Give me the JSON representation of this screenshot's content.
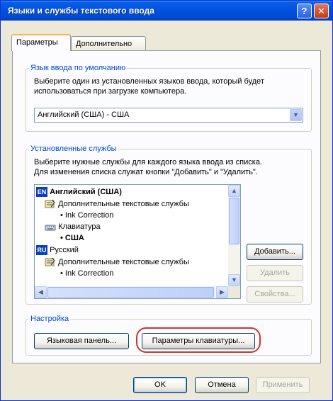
{
  "window": {
    "title": "Языки и службы текстового ввода",
    "help_glyph": "?",
    "close_glyph": "✕"
  },
  "tabs": [
    "Параметры",
    "Дополнительно"
  ],
  "default_language": {
    "legend": "Язык ввода по умолчанию",
    "description_line1": "Выберите один из установленных языков ввода, который будет",
    "description_line2": "использоваться при загрузке компьютера.",
    "selected": "Английский (США) - США"
  },
  "installed_services": {
    "legend": "Установленные службы",
    "description_line1": "Выберите нужные службы для каждого языка ввода из списка.",
    "description_line2": "Для изменения списка служат кнопки \"Добавить\" и \"Удалить\".",
    "tree": {
      "en_badge": "EN",
      "en_label": "Английский (США)",
      "en_text_services": "Дополнительные текстовые службы",
      "en_ink": "Ink Correction",
      "en_keyboard": "Клавиатура",
      "en_keyboard_layout": "США",
      "ru_badge": "RU",
      "ru_label": "Русский",
      "ru_text_services": "Дополнительные текстовые службы",
      "ru_ink": "Ink Correction"
    },
    "bullet": "•",
    "buttons": {
      "add": "Добавить...",
      "remove": "Удалить",
      "properties": "Свойства..."
    }
  },
  "settings": {
    "legend": "Настройка",
    "language_bar": "Языковая панель...",
    "keyboard_settings": "Параметры клавиатуры..."
  },
  "footer": {
    "ok": "OK",
    "cancel": "Отмена",
    "apply": "Применить"
  },
  "colors": {
    "highlight_ring": "#d0342c",
    "group_legend": "#0046d5",
    "title_bar": "#0054e3"
  }
}
